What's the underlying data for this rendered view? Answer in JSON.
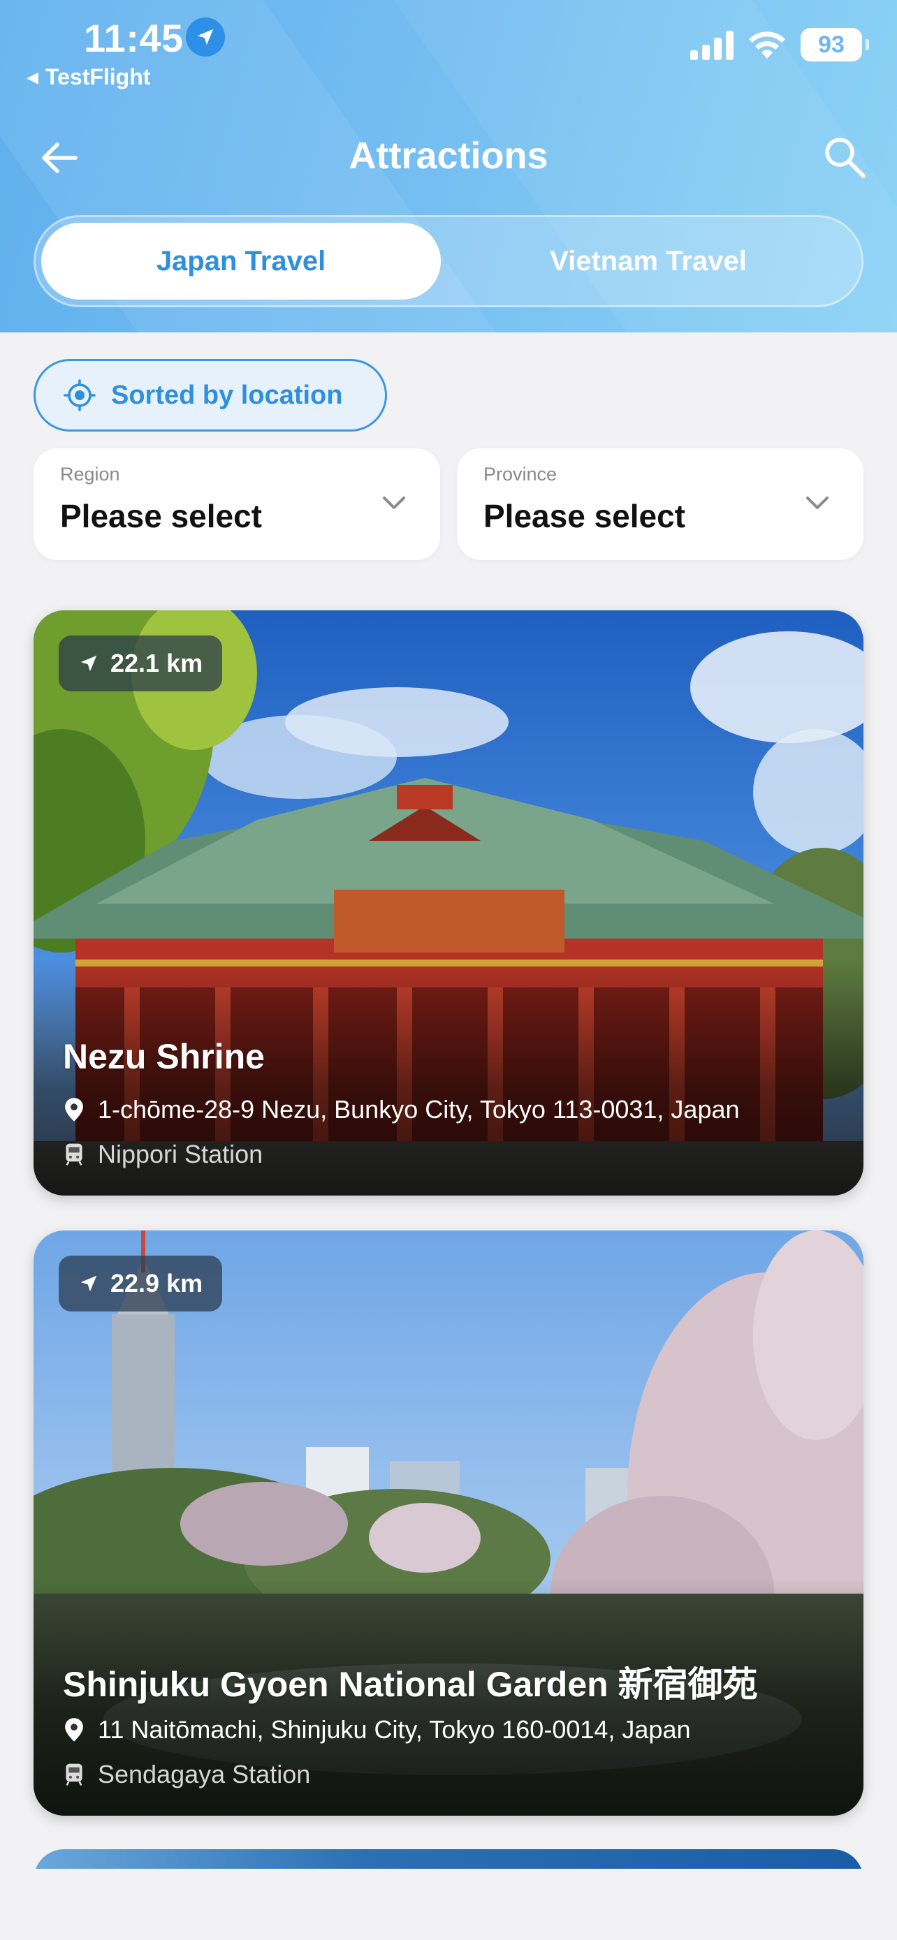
{
  "status_bar": {
    "time": "11:45",
    "back_app": "TestFlight",
    "battery": "93"
  },
  "nav": {
    "title": "Attractions"
  },
  "tabs": [
    {
      "label": "Japan Travel",
      "active": true
    },
    {
      "label": "Vietnam Travel",
      "active": false
    }
  ],
  "sort": {
    "label": "Sorted by location"
  },
  "filters": {
    "region": {
      "label": "Region",
      "value": "Please select"
    },
    "province": {
      "label": "Province",
      "value": "Please select"
    }
  },
  "attractions": [
    {
      "distance": "22.1 km",
      "name": "Nezu Shrine",
      "address": "1-chōme-28-9 Nezu, Bunkyo City, Tokyo 113-0031, Japan",
      "station": "Nippori Station"
    },
    {
      "distance": "22.9 km",
      "name": "Shinjuku Gyoen National Garden 新宿御苑",
      "address": "11 Naitōmachi, Shinjuku City, Tokyo 160-0014, Japan",
      "station": "Sendagaya Station"
    }
  ],
  "colors": {
    "accent": "#2f8fdd",
    "header_start": "#5fb0ee",
    "header_end": "#8dd3f6"
  },
  "icons": {
    "location": "location-arrow-icon",
    "back": "arrow-left-icon",
    "search": "search-icon",
    "sort": "crosshair-icon",
    "dropdown": "chevron-down-icon",
    "pin": "map-pin-icon",
    "train": "train-icon"
  }
}
